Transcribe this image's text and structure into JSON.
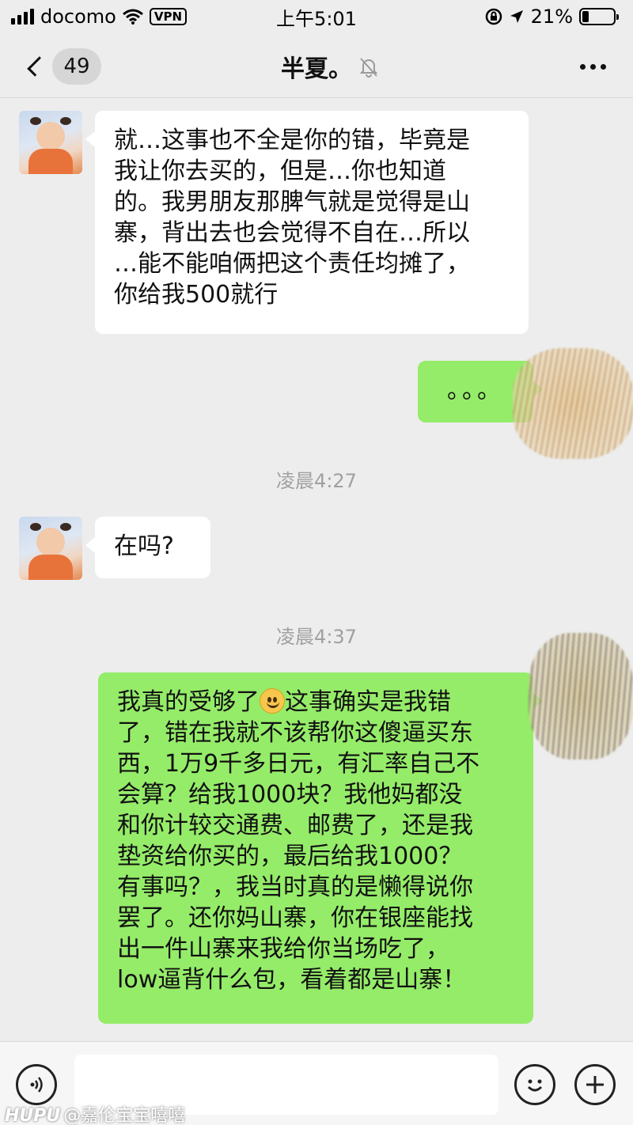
{
  "status_bar": {
    "carrier": "docomo",
    "vpn": "VPN",
    "time": "上午5:01",
    "battery": "21%",
    "battery_level": 0.21
  },
  "nav": {
    "unread_count": "49",
    "title": "半夏。",
    "icons": [
      "back-chevron-icon",
      "mute-bell-icon",
      "more-icon"
    ]
  },
  "messages": [
    {
      "side": "left",
      "lines": [
        "就…这事也不全是你的错，毕竟是",
        "我让你去买的，但是…你也知道",
        "的。我男朋友那脾气就是觉得是山",
        "寨，背出去也会觉得不自在…所以",
        "…能不能咱俩把这个责任均摊了，",
        "你给我500就行"
      ]
    },
    {
      "side": "right",
      "text": "。。。"
    },
    {
      "timestamp": "凌晨4:27"
    },
    {
      "side": "left",
      "text": "在吗?"
    },
    {
      "timestamp": "凌晨4:37"
    },
    {
      "side": "right",
      "lines": [
        "我真的受够了",
        "这事确实是我错",
        "了，错在我就不该帮你这傻逼买东",
        "西，1万9千多日元，有汇率自己不",
        "会算？给我1000块？我他妈都没",
        "和你计较交通费、邮费了，还是我",
        "垫资给你买的，最后给我1000？",
        "有事吗？，我当时真的是懒得说你",
        "罢了。还你妈山寨，你在银座能找",
        "出一件山寨来我给你当场吃了，",
        "low逼背什么包，看着都是山寨！"
      ],
      "emoji": "smile-emoji"
    }
  ],
  "input_bar": {
    "icons": [
      "voice-icon",
      "emoji-icon",
      "plus-icon"
    ],
    "value": ""
  },
  "watermark": {
    "brand": "HUPU",
    "user": "@嘉伦宝宝嘻嘻"
  }
}
